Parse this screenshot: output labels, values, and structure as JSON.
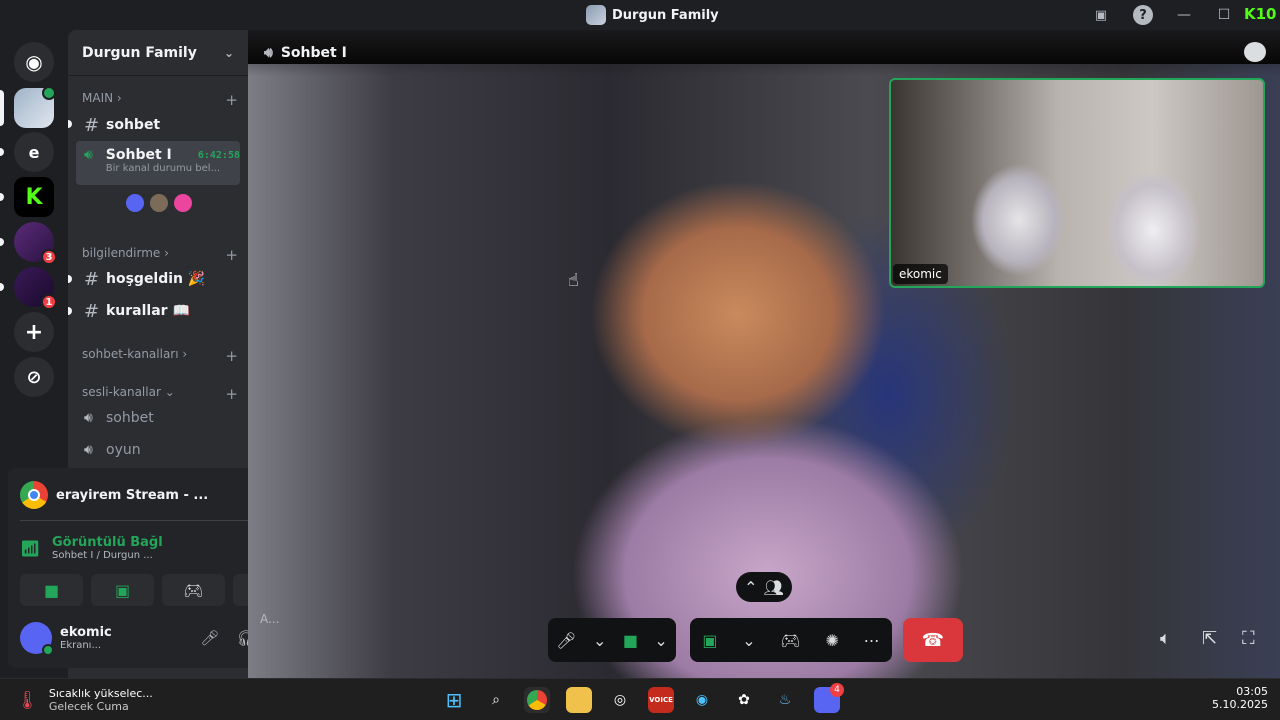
{
  "window": {
    "title": "Durgun Family",
    "controls": [
      "—",
      "☐",
      "✕"
    ]
  },
  "rail": {
    "servers": [
      {
        "name": "discord-home",
        "glyph": "◉"
      },
      {
        "name": "durgun-family",
        "glyph": ""
      },
      {
        "name": "server-e",
        "glyph": "e"
      },
      {
        "name": "kick-server",
        "glyph": "K"
      },
      {
        "name": "server-4",
        "glyph": "",
        "badge": "3"
      },
      {
        "name": "server-5",
        "glyph": "",
        "badge": "1"
      }
    ],
    "add": "+",
    "discover": "⊘"
  },
  "sidebar": {
    "guild_name": "Durgun Family",
    "categories": {
      "main": "MAIN",
      "bilgilendirme": "bilgilendirme",
      "sohbet_kanallari": "sohbet-kanalları",
      "sesli_kanallar": "sesli-kanallar"
    },
    "channels": {
      "sohbet": "sohbet",
      "sohbet_i": "Sohbet I",
      "sohbet_i_time": "6:42:58",
      "sohbet_i_status": "Bir kanal durumu bel...",
      "hosgeldin": "hoşgeldin 🎉",
      "kurallar": "kurallar 📖",
      "voice_sohbet": "sohbet",
      "voice_oyun": "oyun"
    }
  },
  "stream_panel": {
    "stream_title": "erayirem Stream - ...",
    "connection_status": "Görüntülü Bağl",
    "connection_sub": "Sohbet I / Durgun ..."
  },
  "user": {
    "name": "ekomic",
    "status": "Ekranı..."
  },
  "stage": {
    "channel": "Sohbet I",
    "pip_label": "ekomic",
    "stream_label": "A..."
  },
  "taskbar": {
    "weather_title": "Sıcaklık yükselec...",
    "weather_sub": "Gelecek Cuma",
    "time": "03:05",
    "date": "5.10.2025",
    "voicemeeter": "VOICE",
    "discord_badge": "4"
  },
  "colors": {
    "accent_green": "#23a55a",
    "danger": "#da373c",
    "blurple": "#5865f2",
    "kick_green": "#53fc18"
  }
}
